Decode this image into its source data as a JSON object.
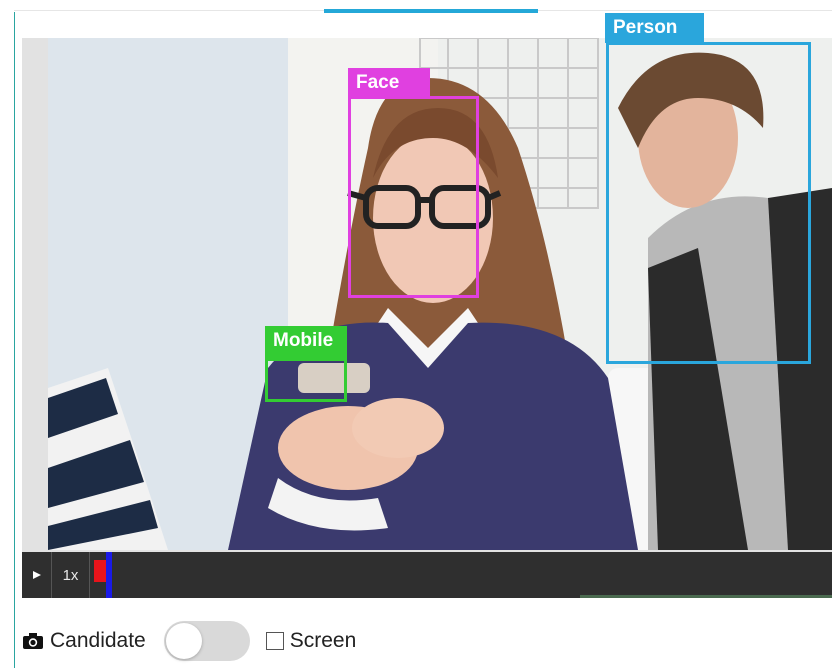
{
  "detections": [
    {
      "label": "Face",
      "color": "#e040e0"
    },
    {
      "label": "Person",
      "color": "#2aa6dc"
    },
    {
      "label": "Mobile",
      "color": "#33cc33"
    }
  ],
  "player": {
    "play_icon": "play-icon",
    "speed_label": "1x",
    "marker_color": "#e8141b",
    "playhead_color": "#1a1ae8"
  },
  "controls": {
    "camera_icon": "camera-icon",
    "candidate_label": "Candidate",
    "toggle_on": false,
    "screen_checked": false,
    "screen_label": "Screen"
  }
}
